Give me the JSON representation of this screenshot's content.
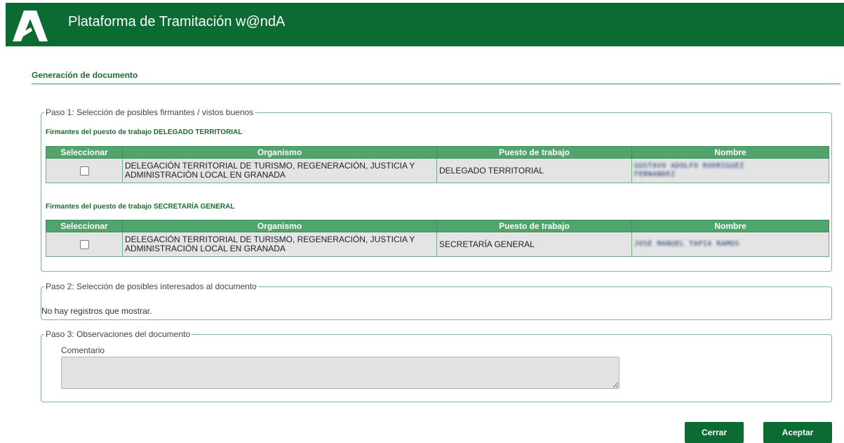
{
  "header": {
    "title": "Plataforma de Tramitación w@ndA",
    "logo_icon": "junta-andalucia-logo-icon",
    "bg_color": "#0b6b33"
  },
  "page": {
    "title": "Generación de documento"
  },
  "step1": {
    "legend": "Paso 1: Selección de posibles firmantes / vistos buenos",
    "columns": [
      "Seleccionar",
      "Organismo",
      "Puesto de trabajo",
      "Nombre"
    ],
    "groups": [
      {
        "title": "Firmantes del puesto de trabajo DELEGADO TERRITORIAL",
        "rows": [
          {
            "selected": false,
            "organismo": "DELEGACIÓN TERRITORIAL DE TURISMO, REGENERACIÓN, JUSTICIA Y ADMINISTRACIÓN LOCAL EN GRANADA",
            "puesto": "DELEGADO TERRITORIAL",
            "nombre_line1": "GUSTAVO ADOLFO RODRIGUEZ",
            "nombre_line2": "FERNANDEZ"
          }
        ]
      },
      {
        "title": "Firmantes del puesto de trabajo SECRETARÍA GENERAL",
        "rows": [
          {
            "selected": false,
            "organismo": "DELEGACIÓN TERRITORIAL DE TURISMO, REGENERACIÓN, JUSTICIA Y ADMINISTRACIÓN LOCAL EN GRANADA",
            "puesto": "SECRETARÍA GENERAL",
            "nombre_line1": "JOSE MANUEL TAPIA RAMOS"
          }
        ]
      }
    ]
  },
  "step2": {
    "legend": "Paso 2: Selección de posibles interesados al documento",
    "empty_message": "No hay registros que mostrar."
  },
  "step3": {
    "legend": "Paso 3: Observaciones del documento",
    "comment_label": "Comentario",
    "comment_value": ""
  },
  "buttons": {
    "close_label": "Cerrar",
    "accept_label": "Aceptar"
  }
}
